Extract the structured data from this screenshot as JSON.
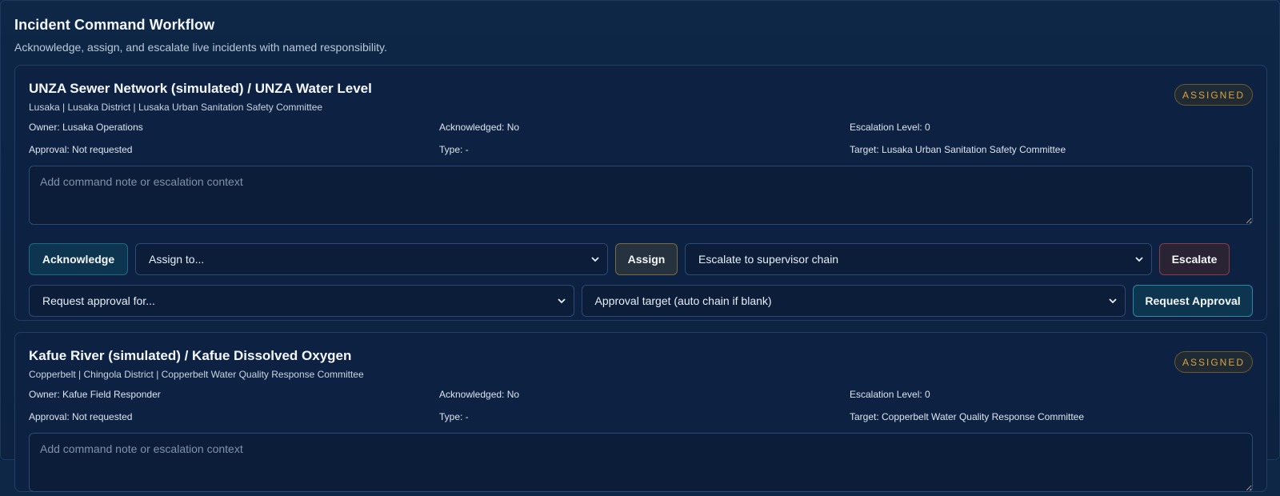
{
  "header": {
    "title": "Incident Command Workflow",
    "subtitle": "Acknowledge, assign, and escalate live incidents with named responsibility."
  },
  "labels": {
    "note_placeholder": "Add command note or escalation context",
    "acknowledge": "Acknowledge",
    "assign_select": "Assign to...",
    "assign": "Assign",
    "escalate_select": "Escalate to supervisor chain",
    "escalate": "Escalate",
    "approval_select": "Request approval for...",
    "approval_target_select": "Approval target (auto chain if blank)",
    "request_approval": "Request Approval"
  },
  "colors": {
    "background": "#0d2242",
    "badge_assigned": "#d9a441",
    "acknowledge_border": "#1d6a86",
    "escalate_border": "#8a3c4c"
  },
  "incidents": [
    {
      "title": "UNZA Sewer Network (simulated) / UNZA Water Level",
      "subtitle": "Lusaka | Lusaka District | Lusaka Urban Sanitation Safety Committee",
      "status": "ASSIGNED",
      "owner": "Owner: Lusaka Operations",
      "acknowledged": "Acknowledged: No",
      "escalation": "Escalation Level: 0",
      "approval": "Approval: Not requested",
      "type": "Type: -",
      "target": "Target: Lusaka Urban Sanitation Safety Committee"
    },
    {
      "title": "Kafue River (simulated) / Kafue Dissolved Oxygen",
      "subtitle": "Copperbelt | Chingola District | Copperbelt Water Quality Response Committee",
      "status": "ASSIGNED",
      "owner": "Owner: Kafue Field Responder",
      "acknowledged": "Acknowledged: No",
      "escalation": "Escalation Level: 0",
      "approval": "Approval: Not requested",
      "type": "Type: -",
      "target": "Target: Copperbelt Water Quality Response Committee"
    }
  ]
}
